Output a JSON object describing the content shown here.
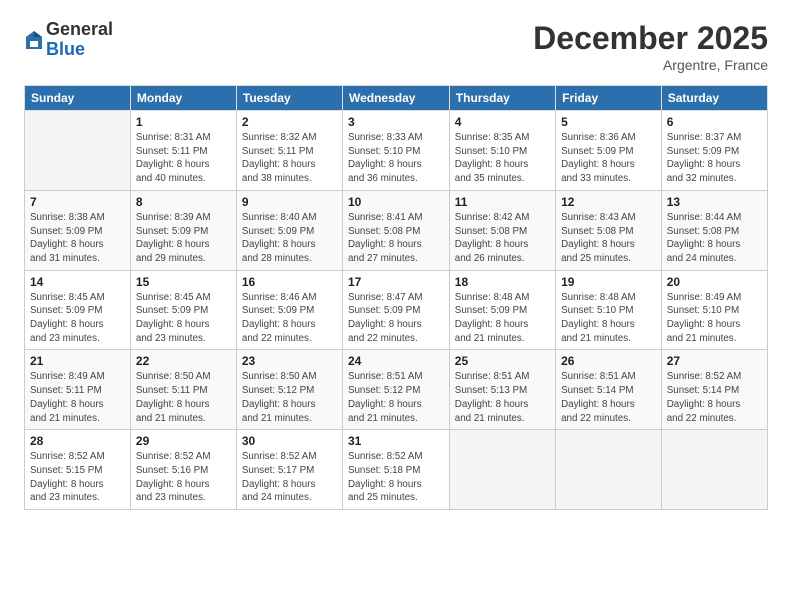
{
  "logo": {
    "general": "General",
    "blue": "Blue"
  },
  "header": {
    "month": "December 2025",
    "location": "Argentre, France"
  },
  "weekdays": [
    "Sunday",
    "Monday",
    "Tuesday",
    "Wednesday",
    "Thursday",
    "Friday",
    "Saturday"
  ],
  "weeks": [
    [
      {
        "day": "",
        "info": ""
      },
      {
        "day": "1",
        "info": "Sunrise: 8:31 AM\nSunset: 5:11 PM\nDaylight: 8 hours\nand 40 minutes."
      },
      {
        "day": "2",
        "info": "Sunrise: 8:32 AM\nSunset: 5:11 PM\nDaylight: 8 hours\nand 38 minutes."
      },
      {
        "day": "3",
        "info": "Sunrise: 8:33 AM\nSunset: 5:10 PM\nDaylight: 8 hours\nand 36 minutes."
      },
      {
        "day": "4",
        "info": "Sunrise: 8:35 AM\nSunset: 5:10 PM\nDaylight: 8 hours\nand 35 minutes."
      },
      {
        "day": "5",
        "info": "Sunrise: 8:36 AM\nSunset: 5:09 PM\nDaylight: 8 hours\nand 33 minutes."
      },
      {
        "day": "6",
        "info": "Sunrise: 8:37 AM\nSunset: 5:09 PM\nDaylight: 8 hours\nand 32 minutes."
      }
    ],
    [
      {
        "day": "7",
        "info": "Sunrise: 8:38 AM\nSunset: 5:09 PM\nDaylight: 8 hours\nand 31 minutes."
      },
      {
        "day": "8",
        "info": "Sunrise: 8:39 AM\nSunset: 5:09 PM\nDaylight: 8 hours\nand 29 minutes."
      },
      {
        "day": "9",
        "info": "Sunrise: 8:40 AM\nSunset: 5:09 PM\nDaylight: 8 hours\nand 28 minutes."
      },
      {
        "day": "10",
        "info": "Sunrise: 8:41 AM\nSunset: 5:08 PM\nDaylight: 8 hours\nand 27 minutes."
      },
      {
        "day": "11",
        "info": "Sunrise: 8:42 AM\nSunset: 5:08 PM\nDaylight: 8 hours\nand 26 minutes."
      },
      {
        "day": "12",
        "info": "Sunrise: 8:43 AM\nSunset: 5:08 PM\nDaylight: 8 hours\nand 25 minutes."
      },
      {
        "day": "13",
        "info": "Sunrise: 8:44 AM\nSunset: 5:08 PM\nDaylight: 8 hours\nand 24 minutes."
      }
    ],
    [
      {
        "day": "14",
        "info": "Sunrise: 8:45 AM\nSunset: 5:09 PM\nDaylight: 8 hours\nand 23 minutes."
      },
      {
        "day": "15",
        "info": "Sunrise: 8:45 AM\nSunset: 5:09 PM\nDaylight: 8 hours\nand 23 minutes."
      },
      {
        "day": "16",
        "info": "Sunrise: 8:46 AM\nSunset: 5:09 PM\nDaylight: 8 hours\nand 22 minutes."
      },
      {
        "day": "17",
        "info": "Sunrise: 8:47 AM\nSunset: 5:09 PM\nDaylight: 8 hours\nand 22 minutes."
      },
      {
        "day": "18",
        "info": "Sunrise: 8:48 AM\nSunset: 5:09 PM\nDaylight: 8 hours\nand 21 minutes."
      },
      {
        "day": "19",
        "info": "Sunrise: 8:48 AM\nSunset: 5:10 PM\nDaylight: 8 hours\nand 21 minutes."
      },
      {
        "day": "20",
        "info": "Sunrise: 8:49 AM\nSunset: 5:10 PM\nDaylight: 8 hours\nand 21 minutes."
      }
    ],
    [
      {
        "day": "21",
        "info": "Sunrise: 8:49 AM\nSunset: 5:11 PM\nDaylight: 8 hours\nand 21 minutes."
      },
      {
        "day": "22",
        "info": "Sunrise: 8:50 AM\nSunset: 5:11 PM\nDaylight: 8 hours\nand 21 minutes."
      },
      {
        "day": "23",
        "info": "Sunrise: 8:50 AM\nSunset: 5:12 PM\nDaylight: 8 hours\nand 21 minutes."
      },
      {
        "day": "24",
        "info": "Sunrise: 8:51 AM\nSunset: 5:12 PM\nDaylight: 8 hours\nand 21 minutes."
      },
      {
        "day": "25",
        "info": "Sunrise: 8:51 AM\nSunset: 5:13 PM\nDaylight: 8 hours\nand 21 minutes."
      },
      {
        "day": "26",
        "info": "Sunrise: 8:51 AM\nSunset: 5:14 PM\nDaylight: 8 hours\nand 22 minutes."
      },
      {
        "day": "27",
        "info": "Sunrise: 8:52 AM\nSunset: 5:14 PM\nDaylight: 8 hours\nand 22 minutes."
      }
    ],
    [
      {
        "day": "28",
        "info": "Sunrise: 8:52 AM\nSunset: 5:15 PM\nDaylight: 8 hours\nand 23 minutes."
      },
      {
        "day": "29",
        "info": "Sunrise: 8:52 AM\nSunset: 5:16 PM\nDaylight: 8 hours\nand 23 minutes."
      },
      {
        "day": "30",
        "info": "Sunrise: 8:52 AM\nSunset: 5:17 PM\nDaylight: 8 hours\nand 24 minutes."
      },
      {
        "day": "31",
        "info": "Sunrise: 8:52 AM\nSunset: 5:18 PM\nDaylight: 8 hours\nand 25 minutes."
      },
      {
        "day": "",
        "info": ""
      },
      {
        "day": "",
        "info": ""
      },
      {
        "day": "",
        "info": ""
      }
    ]
  ]
}
